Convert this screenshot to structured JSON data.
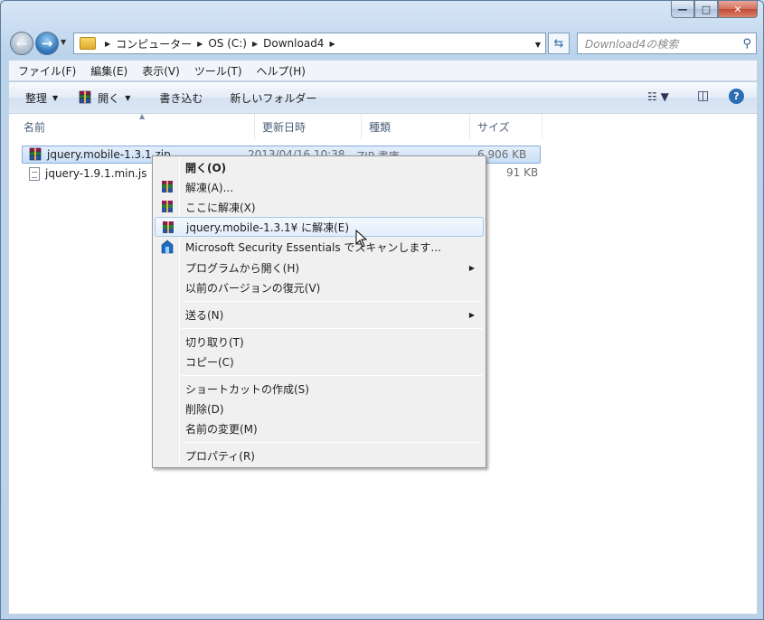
{
  "window": {
    "buttons": {
      "minimize": "—",
      "maximize": "□",
      "close": "✕"
    }
  },
  "nav": {
    "breadcrumbs": [
      "コンピューター",
      "OS (C:)",
      "Download4"
    ],
    "search_placeholder": "Download4の検索"
  },
  "menubar": [
    "ファイル(F)",
    "編集(E)",
    "表示(V)",
    "ツール(T)",
    "ヘルプ(H)"
  ],
  "toolbar": {
    "organize": "整理",
    "open": "開く",
    "burn": "書き込む",
    "new_folder": "新しいフォルダー"
  },
  "columns": [
    "名前",
    "更新日時",
    "種類",
    "サイズ"
  ],
  "files": [
    {
      "name": "jquery.mobile-1.3.1.zip",
      "date": "2013/04/16 10:38",
      "type": "ZIP 書庫",
      "size": "6,906 KB",
      "selected": true
    },
    {
      "name": "jquery-1.9.1.min.js",
      "date": "",
      "type": "",
      "size": "91 KB",
      "selected": false
    }
  ],
  "context_menu": {
    "open": "開く(O)",
    "extract": "解凍(A)...",
    "extract_here": "ここに解凍(X)",
    "extract_to": "jquery.mobile-1.3.1¥ に解凍(E)",
    "mse_scan": "Microsoft Security Essentials でスキャンします...",
    "open_with": "プログラムから開く(H)",
    "restore_prev": "以前のバージョンの復元(V)",
    "send_to": "送る(N)",
    "cut": "切り取り(T)",
    "copy": "コピー(C)",
    "create_shortcut": "ショートカットの作成(S)",
    "delete": "削除(D)",
    "rename": "名前の変更(M)",
    "properties": "プロパティ(R)"
  },
  "colors": {
    "accent": "#2d6fb2",
    "selection": "#c9dff7",
    "menu_bg": "#f0f0f0"
  }
}
